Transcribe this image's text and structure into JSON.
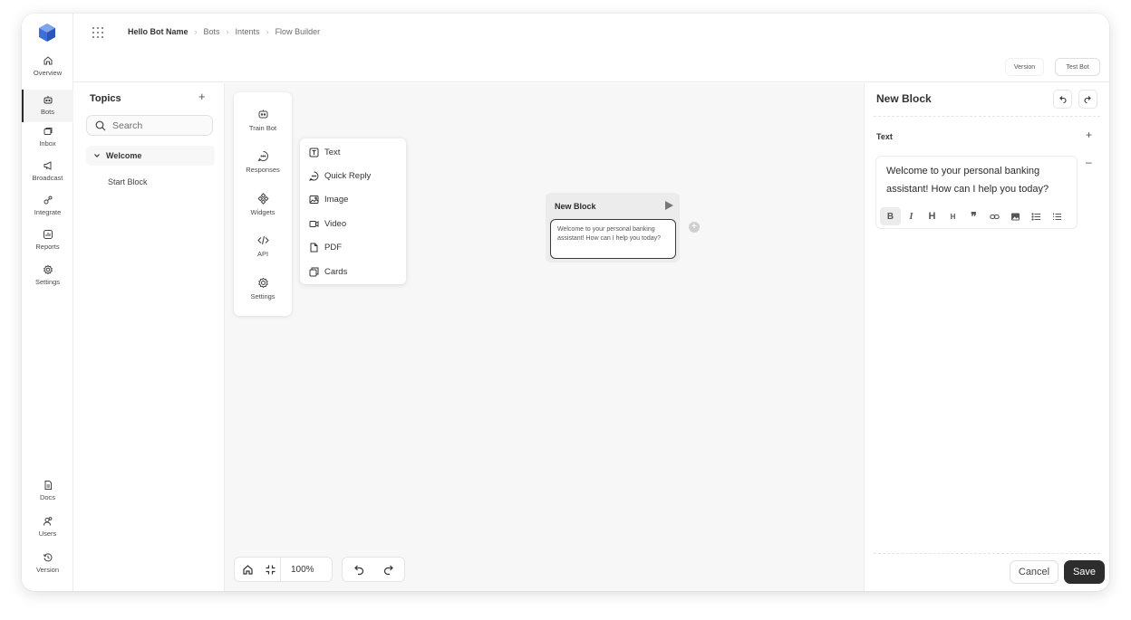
{
  "colors": {
    "accent": "#3e6fd8",
    "primary_button": "#2d2d2d",
    "canvas": "#f7f7f7"
  },
  "nav": {
    "top": [
      {
        "label": "Overview",
        "icon": "home-icon"
      },
      {
        "label": "Bots",
        "icon": "bot-icon",
        "active": true
      },
      {
        "label": "Inbox",
        "icon": "inbox-icon"
      },
      {
        "label": "Broadcast",
        "icon": "megaphone-icon"
      },
      {
        "label": "Integrate",
        "icon": "integrate-icon"
      },
      {
        "label": "Reports",
        "icon": "chart-icon"
      },
      {
        "label": "Settings",
        "icon": "gear-icon"
      }
    ],
    "bottom": [
      {
        "label": "Docs",
        "icon": "document-icon"
      },
      {
        "label": "Users",
        "icon": "users-icon"
      },
      {
        "label": "Version",
        "icon": "history-icon"
      }
    ]
  },
  "breadcrumb": [
    "Hello Bot Name",
    "Bots",
    "Intents",
    "Flow Builder"
  ],
  "header": {
    "version_label": "Version",
    "test_bot_label": "Test Bot"
  },
  "topics": {
    "title": "Topics",
    "search_placeholder": "Search",
    "group": "Welcome",
    "items": [
      "Start Block"
    ]
  },
  "tools": [
    {
      "label": "Train Bot",
      "icon": "train-bot-icon"
    },
    {
      "label": "Responses",
      "icon": "responses-icon"
    },
    {
      "label": "Widgets",
      "icon": "widgets-icon"
    },
    {
      "label": "API",
      "icon": "code-icon"
    },
    {
      "label": "Settings",
      "icon": "gear-icon"
    }
  ],
  "responses": [
    {
      "label": "Text",
      "icon": "text-icon"
    },
    {
      "label": "Quick Reply",
      "icon": "chat-icon"
    },
    {
      "label": "Image",
      "icon": "image-icon"
    },
    {
      "label": "Video",
      "icon": "video-icon"
    },
    {
      "label": "PDF",
      "icon": "pdf-icon"
    },
    {
      "label": "Cards",
      "icon": "cards-icon"
    }
  ],
  "block": {
    "title": "New Block",
    "message": "Welcome to your personal banking assistant! How can I help you today?"
  },
  "zoom": "100%",
  "panel": {
    "title": "New Block",
    "section_label": "Text",
    "editor_text": "Welcome to your personal banking assistant! How can I help you today?",
    "cancel_label": "Cancel",
    "save_label": "Save"
  }
}
